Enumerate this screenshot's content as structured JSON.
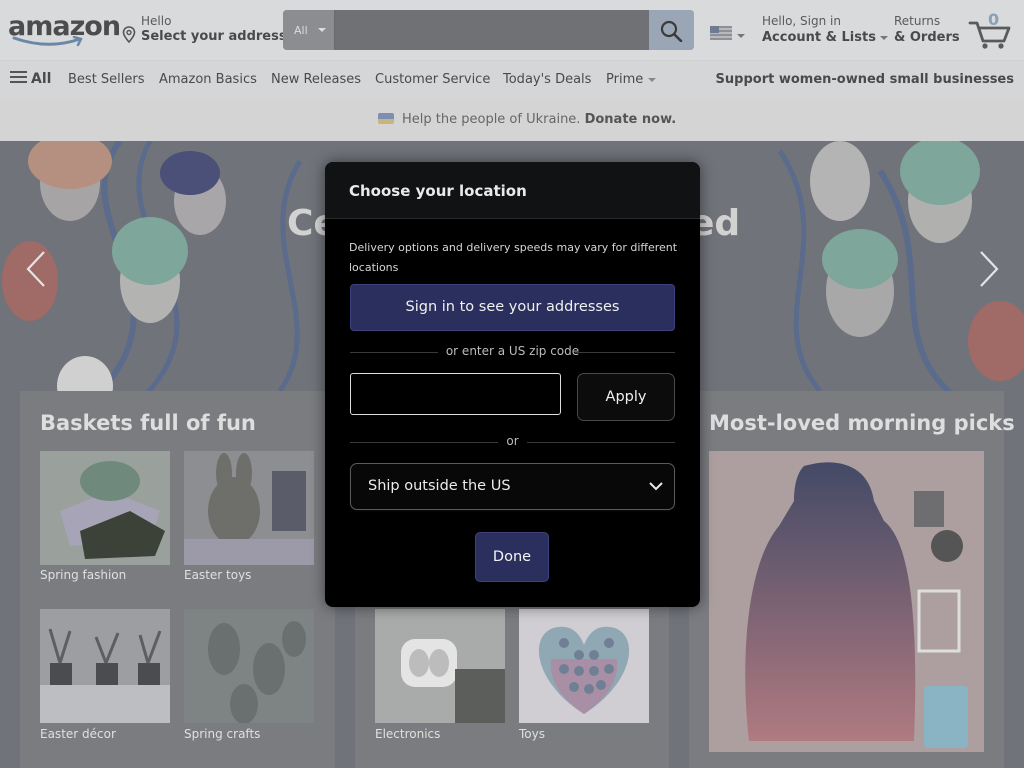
{
  "header": {
    "logo_text": "amazon",
    "deliver": {
      "line1": "Hello",
      "line2": "Select your address"
    },
    "search": {
      "category": "All",
      "placeholder": ""
    },
    "account": {
      "line1": "Hello, Sign in",
      "line2": "Account & Lists"
    },
    "returns": {
      "line1": "Returns",
      "line2": "& Orders"
    },
    "cart": {
      "count": "0"
    }
  },
  "nav": {
    "all_label": "All",
    "links": [
      "Best Sellers",
      "Amazon Basics",
      "New Releases",
      "Customer Service",
      "Today's Deals",
      "Prime"
    ],
    "promo": "Support women-owned small businesses"
  },
  "banner": {
    "text": "Help the people of Ukraine.",
    "link": "Donate now."
  },
  "hero": {
    "title_start": "Ce",
    "title_end": "ed"
  },
  "cards": [
    {
      "title": "Baskets full of fun",
      "tiles": [
        "Spring fashion",
        "Easter toys",
        "Easter décor",
        "Spring crafts"
      ]
    },
    {
      "title": "",
      "tiles": [
        "Electronics",
        "Toys"
      ]
    },
    {
      "title": "Most-loved morning picks"
    }
  ],
  "modal": {
    "title": "Choose your location",
    "description": "Delivery options and delivery speeds may vary for different locations",
    "signin_button": "Sign in to see your addresses",
    "zip_divider": "or enter a US zip code",
    "zip_value": "",
    "apply_button": "Apply",
    "or_divider": "or",
    "ship_select": "Ship outside the US",
    "done_button": "Done"
  },
  "colors": {
    "modal_primary_button": "#2a2f5e",
    "modal_background": "#000000",
    "header_background": "#d9dadb",
    "search_button": "#9aa6b6"
  }
}
